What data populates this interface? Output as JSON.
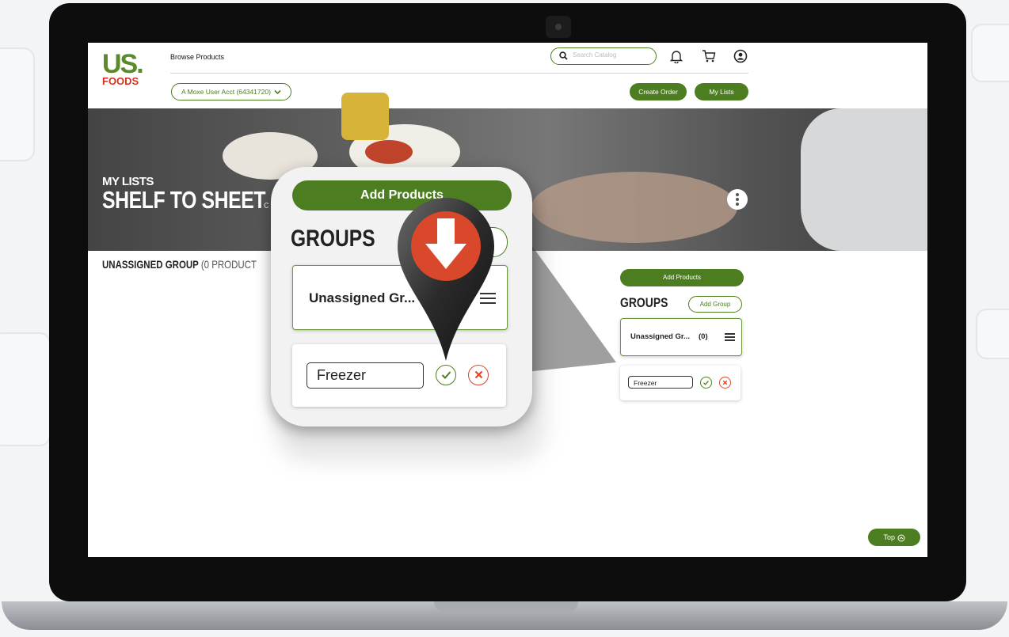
{
  "header": {
    "logo": {
      "top": "US.",
      "bottom": "FOODS"
    },
    "browse_label": "Browse Products",
    "account_selector": "A Moxe User Acct (64341720)",
    "search_placeholder": "Search Catalog",
    "create_order": "Create Order",
    "my_lists": "My Lists"
  },
  "hero": {
    "kicker": "MY LISTS",
    "title": "SHELF TO SHEET",
    "title_suffix": "c"
  },
  "main": {
    "unassigned_label": "UNASSIGNED GROUP",
    "unassigned_count": "(0 PRODUCT"
  },
  "panel": {
    "add_products": "Add Products",
    "groups_title": "GROUPS",
    "add_group": "Add Group",
    "group_name": "Unassigned Gr...",
    "group_count": "(0)",
    "new_group_value": "Freezer"
  },
  "zoom": {
    "add_products": "Add Products",
    "groups_title": "GROUPS",
    "group_name": "Unassigned Gr...",
    "new_group_value": "Freezer"
  },
  "footer": {
    "top_button": "Top"
  },
  "colors": {
    "brand_green": "#4d7d21",
    "cancel_red": "#d9482b",
    "pin_orange": "#d9482b"
  },
  "icons": [
    "search-icon",
    "bell-icon",
    "cart-icon",
    "user-icon",
    "chevron-down-icon",
    "kebab-icon",
    "menu-icon",
    "check-icon",
    "cancel-icon",
    "download-pin-icon",
    "chevron-up-icon"
  ]
}
